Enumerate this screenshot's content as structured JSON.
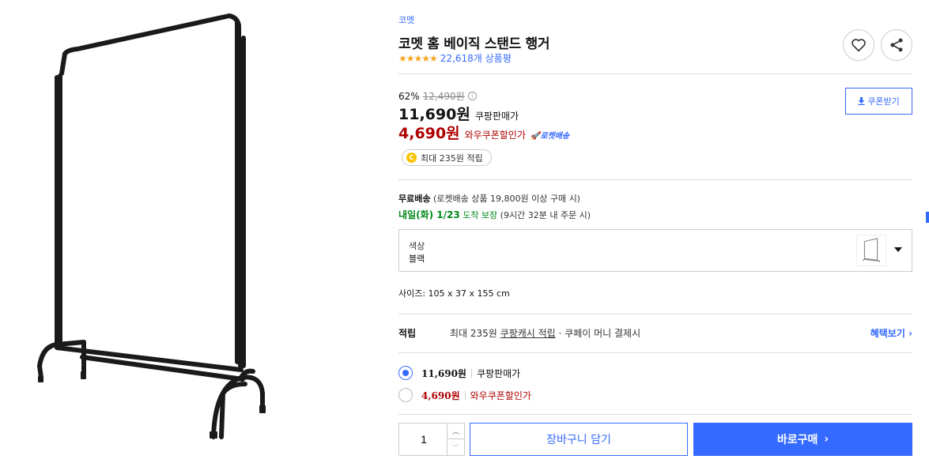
{
  "product": {
    "brand": "코멧",
    "title": "코멧 홈 베이직 스탠드 행거",
    "rating": 4.5,
    "stars_display": "★★★★★",
    "review_count": "22,618개 상품평",
    "image_alt": "black stand hanger"
  },
  "actions": {
    "wish_icon": "heart-icon",
    "share_icon": "share-icon"
  },
  "price": {
    "discount_rate": "62%",
    "original_price": "12,490원",
    "info_icon_glyph": "i",
    "sale_price": "11,690원",
    "sale_label": "쿠팡판매가",
    "wow_price": "4,690원",
    "wow_label": "와우쿠폰할인가",
    "rocket_badge": "🚀로켓배송",
    "coupon_button": "쿠폰받기"
  },
  "cashback": {
    "coin_glyph": "C",
    "text": "최대 235원 적립"
  },
  "shipping": {
    "free_label": "무료배송",
    "condition": " (로켓배송 상품 19,800원 이상 구매 시)",
    "arrival_date": "내일(화) 1/23",
    "arrival_word": " 도착 보장",
    "arrival_note": " (9시간 32분 내 주문 시)"
  },
  "option": {
    "name": "색상",
    "value": "블랙"
  },
  "size": {
    "text": "사이즈: 105 x 37 x 155 cm"
  },
  "earn": {
    "label": "적립",
    "text_prefix": "최대 235원 ",
    "link": "쿠팡캐시 적립",
    "text_suffix": " · 쿠페이 머니 결제시",
    "benefit_link": "혜택보기 ›"
  },
  "price_options": [
    {
      "price": "11,690원",
      "label": "쿠팡판매가",
      "selected": true
    },
    {
      "price": "4,690원",
      "label": "와우쿠폰할인가",
      "selected": false
    }
  ],
  "purchase": {
    "quantity": "1",
    "up_glyph": "︿",
    "down_glyph": "﹀",
    "cart_button": "장바구니 담기",
    "buy_button": "바로구매",
    "buy_arrow": "›"
  },
  "colors": {
    "accent": "#346aff",
    "wow_red": "#ae0000",
    "arrival_green": "#00891a",
    "star": "#f5a623"
  }
}
